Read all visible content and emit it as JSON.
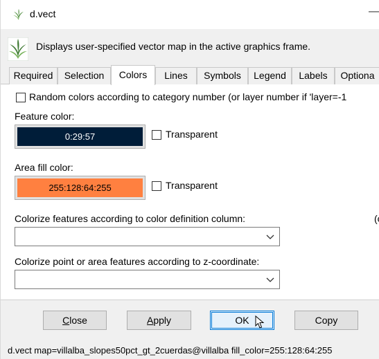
{
  "window": {
    "title": "d.vect",
    "minimize_glyph": "—",
    "app_icon": "grass-icon"
  },
  "description": "Displays user-specified vector map in the active graphics frame.",
  "tabs": [
    {
      "label": "Required"
    },
    {
      "label": "Selection"
    },
    {
      "label": "Colors",
      "active": true
    },
    {
      "label": "Lines"
    },
    {
      "label": "Symbols"
    },
    {
      "label": "Legend"
    },
    {
      "label": "Labels"
    },
    {
      "label": "Optiona"
    }
  ],
  "colors_tab": {
    "random_colors_label": "Random colors according to category number (or layer number if  'layer=-1",
    "random_colors_checked": false,
    "feature_color": {
      "label": "Feature color:",
      "value": "0:29:57",
      "swatch_color": "#001d39",
      "text_color": "#ffffff",
      "transparent_label": "Transparent",
      "transparent_checked": false
    },
    "area_fill_color": {
      "label": "Area fill color:",
      "value": "255:128:64:255",
      "swatch_color": "#ff8040",
      "text_color": "#000000",
      "transparent_label": "Transparent",
      "transparent_checked": false
    },
    "rgb_column": {
      "label": "Colorize features according to color definition column:",
      "value": "",
      "cut_off_text": "(c"
    },
    "zcolor": {
      "label": "Colorize point or area features according to z-coordinate:",
      "value": ""
    }
  },
  "buttons": {
    "close": "Close",
    "apply": "Apply",
    "ok": "OK",
    "copy": "Copy"
  },
  "statusbar": "d.vect map=villalba_slopes50pct_gt_2cuerdas@villalba fill_color=255:128:64:255"
}
